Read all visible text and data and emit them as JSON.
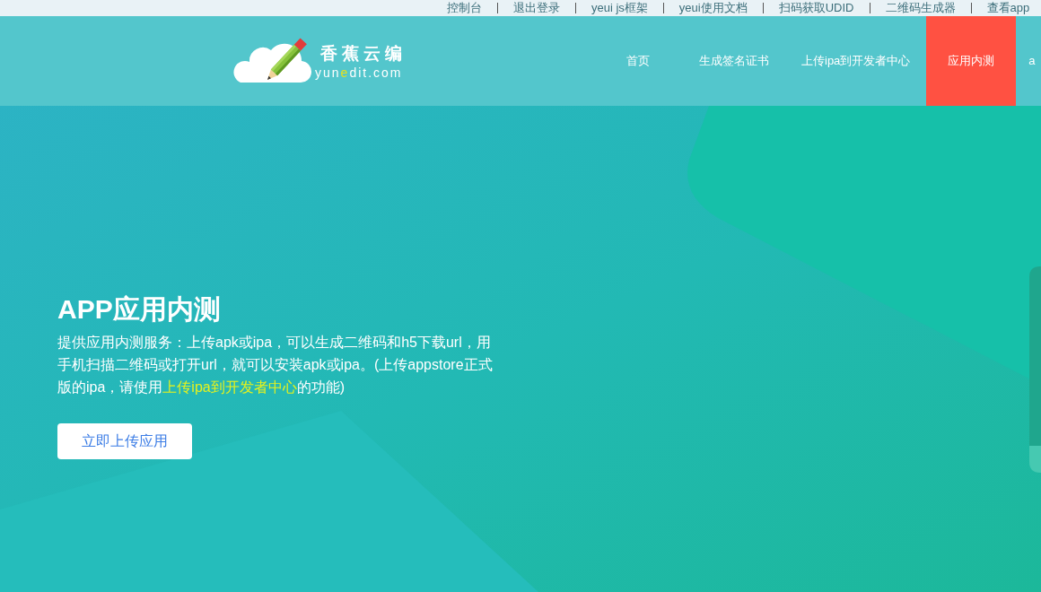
{
  "top_links": [
    "控制台",
    "退出登录",
    "yeui js框架",
    "yeui使用文档",
    "扫码获取UDID",
    "二维码生成器",
    "查看app"
  ],
  "header": {
    "logo": {
      "name": "香蕉云编",
      "domain": [
        {
          "text": "yun",
          "highlight": false
        },
        {
          "text": "e",
          "highlight": true
        },
        {
          "text": "dit.com",
          "highlight": false
        }
      ]
    },
    "nav": [
      {
        "label": "首页",
        "selected": false
      },
      {
        "label": "生成签名证书",
        "selected": false
      },
      {
        "label": "上传ipa到开发者中心",
        "selected": false
      },
      {
        "label": "应用内测",
        "selected": true
      },
      {
        "label": "a",
        "selected": false
      }
    ]
  },
  "hero": {
    "title": "APP应用内测",
    "description": {
      "text": "提供应用内测服务：上传apk或ipa，可以生成二维码和h5下载url，用手机扫描二维码或打开url，就可以安装apk或ipa。(上传appstore正式版的ipa，请使用",
      "link": "上传ipa到开发者中心",
      "after": "的功能)"
    },
    "button": "立即上传应用"
  }
}
